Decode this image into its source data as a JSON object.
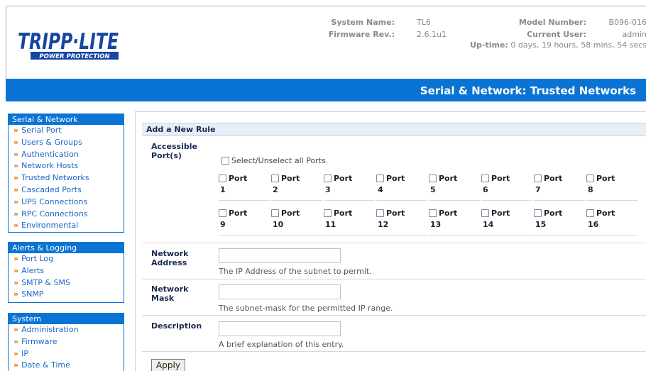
{
  "header": {
    "logo_text": "TRIPP·LITE",
    "logo_sub": "POWER PROTECTION",
    "system_name_label": "System Name:",
    "system_name_value": "TL6",
    "firmware_label": "Firmware Rev.:",
    "firmware_value": "2.6.1u1",
    "model_label": "Model Number:",
    "model_value": "B096-016",
    "user_label": "Current User:",
    "user_value": "admin",
    "uptime_label": "Up-time:",
    "uptime_value": "0 days, 19 hours, 58 mins, 54 secs"
  },
  "page_title": "Serial & Network: Trusted Networks",
  "sidebar": [
    {
      "heading": "Serial & Network",
      "items": [
        "Serial Port",
        "Users & Groups",
        "Authentication",
        "Network Hosts",
        "Trusted Networks",
        "Cascaded Ports",
        "UPS Connections",
        "RPC Connections",
        "Environmental"
      ]
    },
    {
      "heading": "Alerts & Logging",
      "items": [
        "Port Log",
        "Alerts",
        "SMTP & SMS",
        "SNMP"
      ]
    },
    {
      "heading": "System",
      "items": [
        "Administration",
        "Firmware",
        "IP",
        "Date & Time"
      ]
    }
  ],
  "form": {
    "section_title": "Add a New Rule",
    "ports_label_1": "Accessible",
    "ports_label_2": "Port(s)",
    "select_all_label": "Select/Unselect all Ports.",
    "port_word": "Port",
    "ports": [
      "1",
      "2",
      "3",
      "4",
      "5",
      "6",
      "7",
      "8",
      "9",
      "10",
      "11",
      "12",
      "13",
      "14",
      "15",
      "16"
    ],
    "network_address_label_1": "Network",
    "network_address_label_2": "Address",
    "network_address_value": "",
    "network_address_hint": "The IP Address of the subnet to permit.",
    "network_mask_label_1": "Network",
    "network_mask_label_2": "Mask",
    "network_mask_value": "",
    "network_mask_hint": "The subnet-mask for the permitted IP range.",
    "description_label": "Description",
    "description_value": "",
    "description_hint": "A brief explanation of this entry.",
    "apply_label": "Apply"
  },
  "colors": {
    "brand_blue": "#0a74d4",
    "link_blue": "#1a66c9",
    "bullet_orange": "#e07000"
  }
}
